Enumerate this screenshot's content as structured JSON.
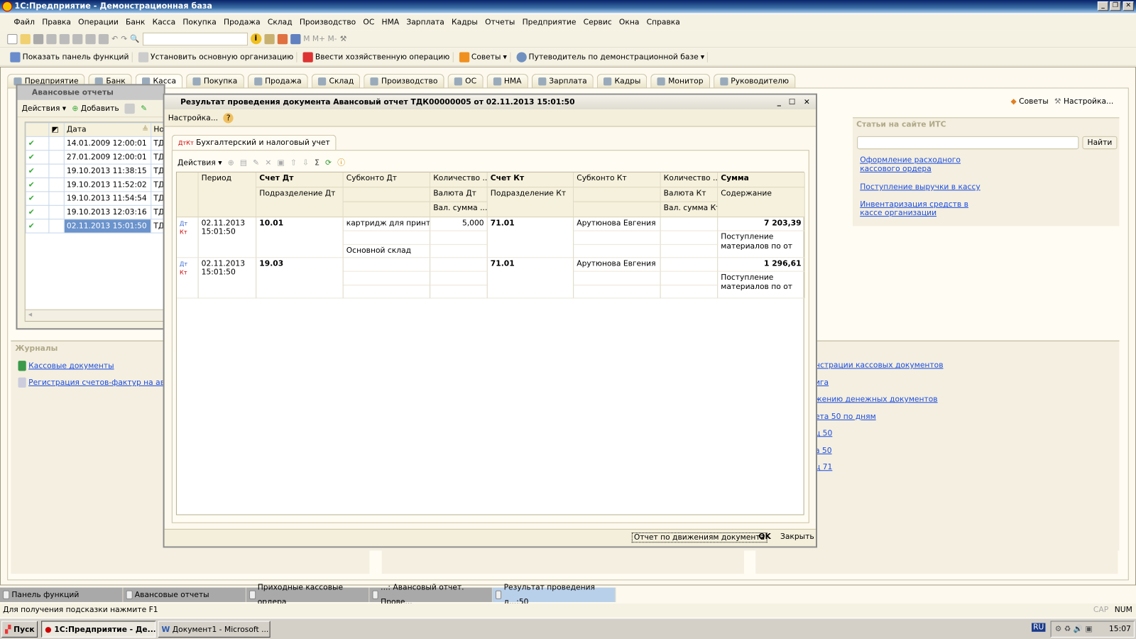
{
  "app": {
    "title": "1С:Предприятие - Демонстрационная база"
  },
  "menu": [
    "Файл",
    "Правка",
    "Операции",
    "Банк",
    "Касса",
    "Покупка",
    "Продажа",
    "Склад",
    "Производство",
    "ОС",
    "НМА",
    "Зарплата",
    "Кадры",
    "Отчеты",
    "Предприятие",
    "Сервис",
    "Окна",
    "Справка"
  ],
  "toolbar2": {
    "show_panel": "Показать панель функций",
    "set_org": "Установить основную организацию",
    "enter_op": "Ввести хозяйственную операцию",
    "tips": "Советы",
    "guide": "Путеводитель по демонстрационной базе"
  },
  "tabs": [
    "Предприятие",
    "Банк",
    "Касса",
    "Покупка",
    "Продажа",
    "Склад",
    "Производство",
    "ОС",
    "НМА",
    "Зарплата",
    "Кадры",
    "Монитор",
    "Руководителю"
  ],
  "panel": {
    "tips": "Советы",
    "settings": "Настройка...",
    "its_title": "Статьи на сайте ИТС",
    "find": "Найти",
    "search_value": "",
    "its_links": [
      "Оформление расходного кассового ордера",
      "Поступление выручки в кассу",
      "Инвентаризация средств в кассе организации"
    ],
    "journals_title": "Журналы",
    "journals": [
      "Кассовые документы",
      "Регистрация счетов-фактур на аванс"
    ],
    "reports_partial": [
      "нстрации кассовых документов",
      "ига",
      "жению денежных документов",
      "ета 50 по дням",
      "ц 50",
      "а 50",
      "ц 71"
    ]
  },
  "advance": {
    "title": "Авансовые отчеты",
    "actions": "Действия",
    "add": "Добавить",
    "col_date": "Дата",
    "col_num": "Но",
    "rows": [
      {
        "date": "14.01.2009 12:00:01",
        "num": "ТД"
      },
      {
        "date": "27.01.2009 12:00:01",
        "num": "ТД"
      },
      {
        "date": "19.10.2013 11:38:15",
        "num": "ТД"
      },
      {
        "date": "19.10.2013 11:52:02",
        "num": "ТД"
      },
      {
        "date": "19.10.2013 11:54:54",
        "num": "ТД"
      },
      {
        "date": "19.10.2013 12:03:16",
        "num": "ТД"
      },
      {
        "date": "02.11.2013 15:01:50",
        "num": "ТД"
      }
    ],
    "selected_index": 6
  },
  "result": {
    "title": "Результат проведения документа Авансовый отчет ТДК00000005 от 02.11.2013 15:01:50",
    "settings": "Настройка...",
    "tab": "Бухгалтерский и налоговый учет",
    "actions": "Действия",
    "headers": {
      "period": "Период",
      "acc_dt": "Счет Дт",
      "subk_dt": "Субконто Дт",
      "qty_dt": "Количество ...",
      "acc_kt": "Счет Кт",
      "subk_kt": "Субконто Кт",
      "qty_kt": "Количество ...",
      "sum": "Сумма",
      "div_dt": "Подразделение Дт",
      "cur_dt": "Валюта Дт",
      "div_kt": "Подразделение Кт",
      "cur_kt": "Валюта Кт",
      "content": "Содержание",
      "vsum_dt": "Вал. сумма ...",
      "vsum_kt": "Вал. сумма Кт"
    },
    "rows": [
      {
        "period": "02.11.2013 15:01:50",
        "acc_dt": "10.01",
        "subk_dt1": "картридж для принт...",
        "subk_dt3": "Основной склад",
        "qty_dt": "5,000",
        "acc_kt": "71.01",
        "subk_kt": "Арутюнова Евгения",
        "sum": "7 203,39",
        "content": "Поступление материалов по   от"
      },
      {
        "period": "02.11.2013 15:01:50",
        "acc_dt": "19.03",
        "subk_dt1": "",
        "subk_dt3": "",
        "qty_dt": "",
        "acc_kt": "71.01",
        "subk_kt": "Арутюнова Евгения",
        "sum": "1 296,61",
        "content": "Поступление материалов по   от"
      }
    ],
    "report_btn": "Отчет по движениям документа",
    "ok": "OK",
    "close": "Закрыть"
  },
  "window_tabs": [
    "Панель функций",
    "Авансовые отчеты",
    "Приходные кассовые ордера",
    "...: Авансовый отчет. Прове...",
    "Результат проведения д...:50"
  ],
  "status": {
    "hint": "Для получения подсказки нажмите F1",
    "cap": "CAP",
    "num": "NUM"
  },
  "taskbar": {
    "start": "Пуск",
    "items": [
      "1С:Предприятие - Де...",
      "Документ1 - Microsoft ..."
    ],
    "lang": "RU",
    "clock": "15:07"
  }
}
